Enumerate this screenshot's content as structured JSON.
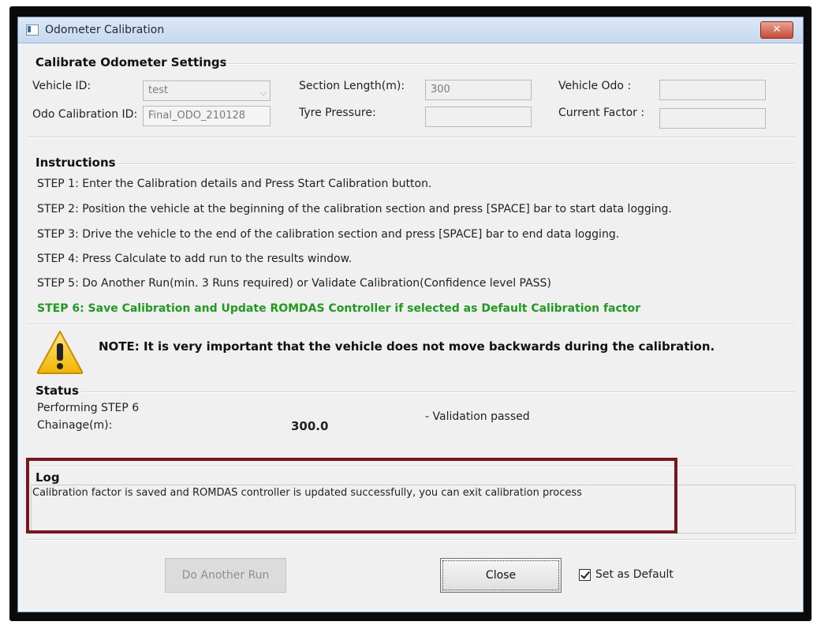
{
  "window": {
    "title": "Odometer Calibration",
    "close_label": "✕"
  },
  "settings": {
    "group_title": "Calibrate Odometer Settings",
    "vehicle_id_label": "Vehicle ID:",
    "vehicle_id_value": "test",
    "odo_calibration_id_label": "Odo Calibration ID:",
    "odo_calibration_id_value": "Final_ODO_210128",
    "section_length_label": "Section Length(m):",
    "section_length_value": "300",
    "tyre_pressure_label": "Tyre Pressure:",
    "tyre_pressure_value": "",
    "vehicle_odo_label": "Vehicle Odo :",
    "vehicle_odo_value": "",
    "current_factor_label": "Current Factor :",
    "current_factor_value": ""
  },
  "instructions": {
    "group_title": "Instructions",
    "steps": [
      "STEP 1:  Enter the Calibration details and Press Start Calibration button.",
      "STEP 2:  Position the vehicle at the beginning of the calibration section and press [SPACE] bar to start data logging.",
      "STEP 3:  Drive the vehicle to the end of the calibration section and press [SPACE] bar to end data logging.",
      "STEP 4:  Press Calculate to add run to the results window.",
      "STEP 5:  Do Another Run(min. 3 Runs required) or Validate Calibration(Confidence level PASS)",
      "STEP 6:  Save Calibration and Update ROMDAS Controller if selected as Default Calibration factor"
    ],
    "step6_color": "#1f9b1f"
  },
  "note": {
    "text": "NOTE: It is very important that the vehicle does not move backwards during the calibration.",
    "icon": "warning-icon"
  },
  "status": {
    "group_title": "Status",
    "current_step": "Performing STEP 6",
    "chainage_label": "Chainage(m):",
    "chainage_value": "300.0",
    "validation_text": "- Validation passed"
  },
  "log": {
    "group_title": "Log",
    "message": "Calibration factor is saved and ROMDAS controller is updated successfully, you can exit calibration process",
    "highlight_color": "#7a1520"
  },
  "footer": {
    "do_another_run_label": "Do Another Run",
    "close_label": "Close",
    "set_as_default_label": "Set as Default",
    "set_as_default_checked": true
  }
}
